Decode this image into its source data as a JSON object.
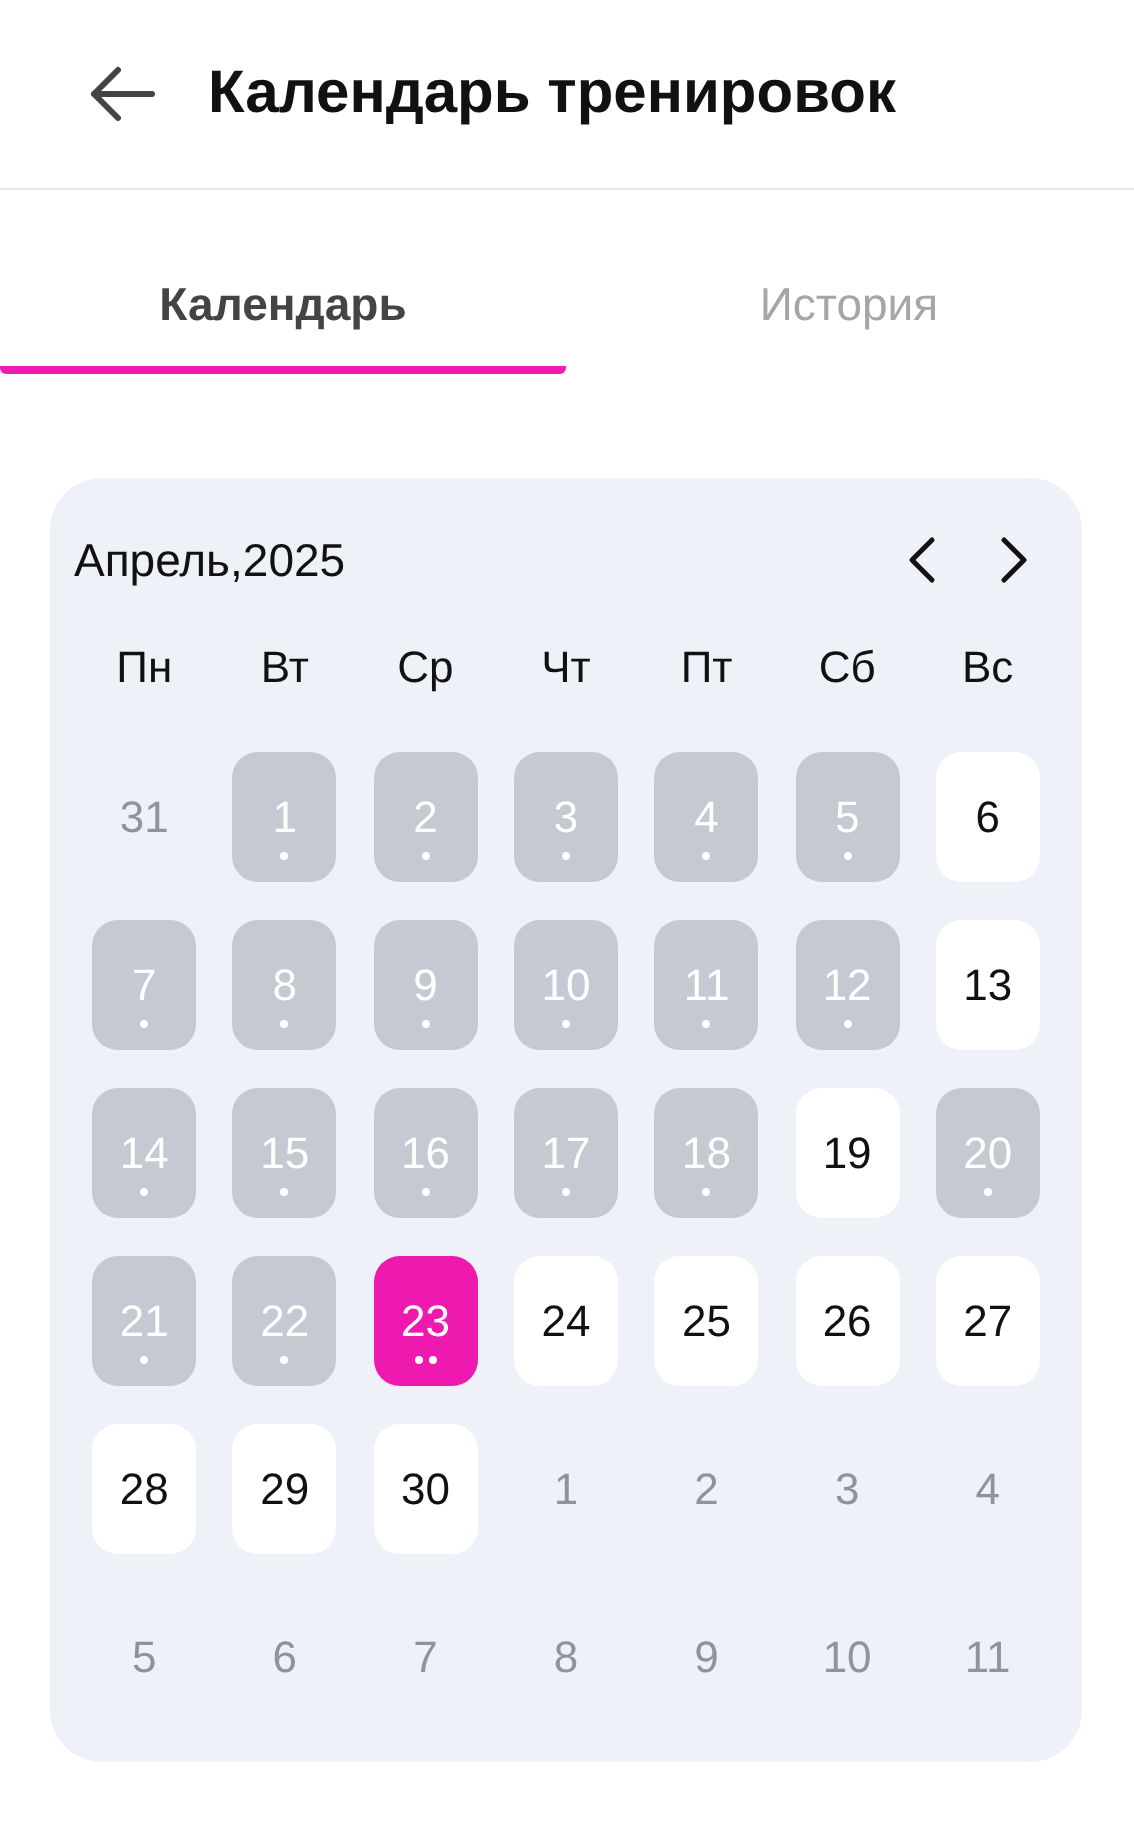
{
  "header": {
    "title": "Календарь тренировок"
  },
  "tabs": [
    {
      "label": "Календарь",
      "selected": true
    },
    {
      "label": "История",
      "selected": false
    }
  ],
  "calendar": {
    "month": "Апрель,2025",
    "weekdays": [
      "Пн",
      "Вт",
      "Ср",
      "Чт",
      "Пт",
      "Сб",
      "Вс"
    ],
    "days": [
      {
        "label": "31",
        "kind": "outside",
        "workout": false
      },
      {
        "label": "1",
        "kind": "past",
        "workout": true
      },
      {
        "label": "2",
        "kind": "past",
        "workout": true
      },
      {
        "label": "3",
        "kind": "past",
        "workout": true
      },
      {
        "label": "4",
        "kind": "past",
        "workout": true
      },
      {
        "label": "5",
        "kind": "past",
        "workout": true
      },
      {
        "label": "6",
        "kind": "free",
        "workout": false
      },
      {
        "label": "7",
        "kind": "past",
        "workout": true
      },
      {
        "label": "8",
        "kind": "past",
        "workout": true
      },
      {
        "label": "9",
        "kind": "past",
        "workout": true
      },
      {
        "label": "10",
        "kind": "past",
        "workout": true
      },
      {
        "label": "11",
        "kind": "past",
        "workout": true
      },
      {
        "label": "12",
        "kind": "past",
        "workout": true
      },
      {
        "label": "13",
        "kind": "free",
        "workout": false
      },
      {
        "label": "14",
        "kind": "past",
        "workout": true
      },
      {
        "label": "15",
        "kind": "past",
        "workout": true
      },
      {
        "label": "16",
        "kind": "past",
        "workout": true
      },
      {
        "label": "17",
        "kind": "past",
        "workout": true
      },
      {
        "label": "18",
        "kind": "past",
        "workout": true
      },
      {
        "label": "19",
        "kind": "free",
        "workout": false
      },
      {
        "label": "20",
        "kind": "past",
        "workout": true
      },
      {
        "label": "21",
        "kind": "past",
        "workout": true
      },
      {
        "label": "22",
        "kind": "past",
        "workout": true
      },
      {
        "label": "23",
        "kind": "selected",
        "workout": true,
        "multiple": true
      },
      {
        "label": "24",
        "kind": "free",
        "workout": false
      },
      {
        "label": "25",
        "kind": "free",
        "workout": false
      },
      {
        "label": "26",
        "kind": "free",
        "workout": false
      },
      {
        "label": "27",
        "kind": "free",
        "workout": false
      },
      {
        "label": "28",
        "kind": "free",
        "workout": false
      },
      {
        "label": "29",
        "kind": "free",
        "workout": false
      },
      {
        "label": "30",
        "kind": "free",
        "workout": false
      },
      {
        "label": "1",
        "kind": "outside",
        "workout": false
      },
      {
        "label": "2",
        "kind": "outside",
        "workout": false
      },
      {
        "label": "3",
        "kind": "outside",
        "workout": false
      },
      {
        "label": "4",
        "kind": "outside",
        "workout": false
      },
      {
        "label": "5",
        "kind": "outside",
        "workout": false
      },
      {
        "label": "6",
        "kind": "outside",
        "workout": false
      },
      {
        "label": "7",
        "kind": "outside",
        "workout": false
      },
      {
        "label": "8",
        "kind": "outside",
        "workout": false
      },
      {
        "label": "9",
        "kind": "outside",
        "workout": false
      },
      {
        "label": "10",
        "kind": "outside",
        "workout": false
      },
      {
        "label": "11",
        "kind": "outside",
        "workout": false
      }
    ]
  }
}
